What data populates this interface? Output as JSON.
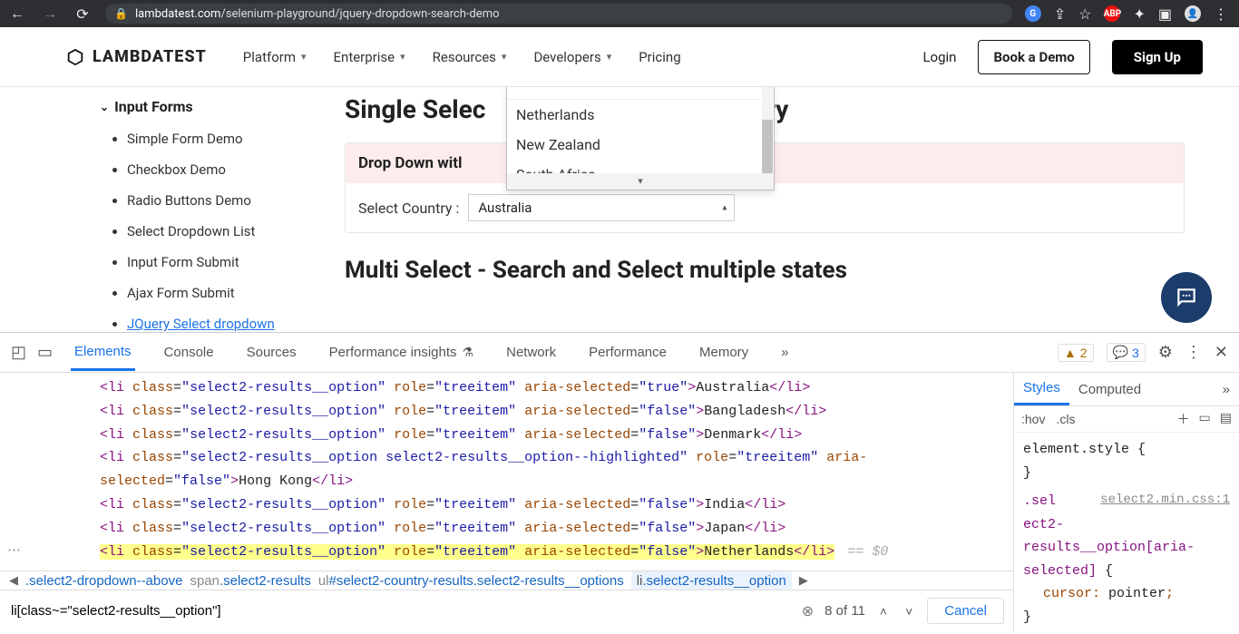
{
  "browser": {
    "url_domain": "lambdatest.com",
    "url_path": "/selenium-playground/jquery-dropdown-search-demo",
    "icons": {
      "abp": "ABP"
    }
  },
  "header": {
    "logo": "LAMBDATEST",
    "nav": [
      "Platform",
      "Enterprise",
      "Resources",
      "Developers",
      "Pricing"
    ],
    "login": "Login",
    "book_demo": "Book a Demo",
    "signup": "Sign Up"
  },
  "sidebar": {
    "section": "Input Forms",
    "items": [
      "Simple Form Demo",
      "Checkbox Demo",
      "Radio Buttons Demo",
      "Select Dropdown List",
      "Input Form Submit",
      "Ajax Form Submit",
      "JQuery Select dropdown"
    ]
  },
  "main": {
    "h1_prefix": "Single Selec",
    "h1_suffix": "try",
    "panel_header_prefix": "Drop Down witl",
    "label": "Select Country :",
    "selected": "Australia",
    "h2": "Multi Select - Search and Select multiple states"
  },
  "dropdown": {
    "options": [
      "Netherlands",
      "New Zealand",
      "South Africa"
    ]
  },
  "devtools": {
    "tabs": [
      "Elements",
      "Console",
      "Sources",
      "Performance insights",
      "Network",
      "Performance",
      "Memory"
    ],
    "warn_count": "2",
    "info_count": "3",
    "lines": [
      {
        "text": "Australia",
        "sel": "true",
        "hl": false,
        "cls": "select2-results__option"
      },
      {
        "text": "Bangladesh",
        "sel": "false",
        "hl": false,
        "cls": "select2-results__option"
      },
      {
        "text": "Denmark",
        "sel": "false",
        "hl": false,
        "cls": "select2-results__option"
      },
      {
        "text": "Hong Kong",
        "sel": "false",
        "hl": false,
        "cls": "select2-results__option select2-results__option--highlighted",
        "wrap": true
      },
      {
        "text": "India",
        "sel": "false",
        "hl": false,
        "cls": "select2-results__option"
      },
      {
        "text": "Japan",
        "sel": "false",
        "hl": false,
        "cls": "select2-results__option"
      },
      {
        "text": "Netherlands",
        "sel": "false",
        "hl": true,
        "cls": "select2-results__option"
      }
    ],
    "eq0": "== $0",
    "breadcrumb": [
      {
        "el": "",
        "cls": ".select2-dropdown--above",
        "trunc": true
      },
      {
        "el": "span",
        "cls": ".select2-results"
      },
      {
        "el": "ul",
        "id": "#select2-country-results",
        "cls": ".select2-results__options"
      },
      {
        "el": "li",
        "cls": ".select2-results__option",
        "active": true
      }
    ],
    "search_value": "li[class~=\"select2-results__option\"]",
    "search_count": "8 of 11",
    "cancel": "Cancel"
  },
  "styles": {
    "tabs": [
      "Styles",
      "Computed"
    ],
    "hov": ":hov",
    "cls": ".cls",
    "elstyle_label": "element.style",
    "src": "select2.min.css:1",
    "selector": ".select2-results__option[aria-selected]",
    "prop": "cursor",
    "val": "pointer"
  }
}
